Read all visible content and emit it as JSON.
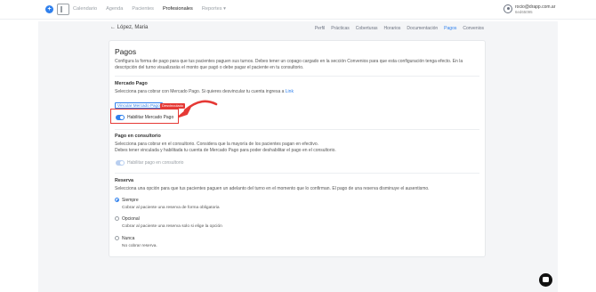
{
  "topbar": {
    "logo_glyph": "+",
    "nav": [
      "Calendario",
      "Agenda",
      "Pacientes",
      "Profesionales",
      "Reportes ▾"
    ],
    "nav_active": "Profesionales",
    "user_email": "rocio@drapp.com.ar",
    "user_sub": "6ed65095"
  },
  "header": {
    "back_label": "← López, Maria",
    "tabs": [
      "Perfil",
      "Prácticas",
      "Coberturas",
      "Horarios",
      "Documentación",
      "Pagos",
      "Convenios"
    ],
    "active_tab": "Pagos"
  },
  "pagos": {
    "title": "Pagos",
    "description": "Configura la forma de pago para que tus pacientes paguen sus turnos. Debes tener un copago cargado en la sección Convenios para que esta configuración tenga efecto. En la descripción del turno visualizarás el monto que pagó o debe pagar el paciente en tu consultorio."
  },
  "mercado_pago": {
    "title": "Mercado Pago",
    "text": "Selecciona para cobrar con Mercado Pago. Si quieres desvincular tu cuenta ingresa a",
    "link": "Link",
    "vincular_label": "Vincular Mercado Pago",
    "badge": "Desvinculado",
    "toggle_label": "Habilitar Mercado Pago",
    "toggle_on": true
  },
  "consultorio": {
    "title": "Pago en consultorio",
    "text1": "Selecciona para cobrar en el consultorio. Considera que la mayoría de los pacientes pagan en efectivo.",
    "text2": "Debes tener vinculada y habilitada tu cuenta de Mercado Pago para poder deshabilitar el pago en el consultorio.",
    "toggle_label": "Habilitar pago en consultorio",
    "toggle_on": true
  },
  "reserva": {
    "title": "Reserva",
    "text": "Selecciona una opción para que tus pacientes paguen un adelanto del turno en el momento que lo confirman. El pago de una reserva disminuye el ausentismo.",
    "options": [
      {
        "label": "Siempre",
        "desc": "Cobrar al paciente una reserva de forma obligatoria",
        "checked": true
      },
      {
        "label": "Opcional",
        "desc": "Cobrar al paciente una reserva solo si elige la opción",
        "checked": false
      },
      {
        "label": "Nunca",
        "desc": "No cobrar reserva.",
        "checked": false
      }
    ]
  },
  "colors": {
    "accent": "#2f80ed",
    "highlight": "#e53935"
  }
}
